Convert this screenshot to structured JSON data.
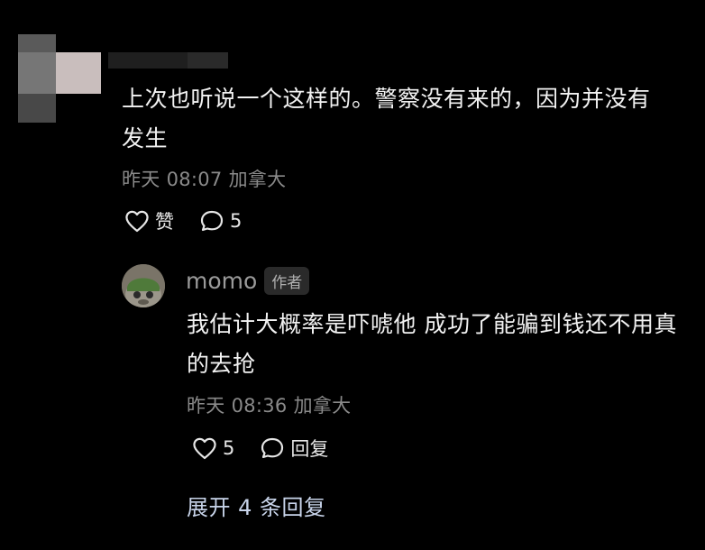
{
  "comment": {
    "text": "上次也听说一个这样的。警察没有来的，因为并没有发生",
    "meta": "昨天 08:07 加拿大",
    "like_label": "赞",
    "reply_count": "5"
  },
  "reply": {
    "username": "momo",
    "badge": "作者",
    "text": "我估计大概率是吓唬他 成功了能骗到钱还不用真的去抢",
    "meta": "昨天 08:36 加拿大",
    "like_count": "5",
    "reply_label": "回复"
  },
  "expand_label": "展开 4 条回复",
  "icons": {
    "like": "heart-outline-icon",
    "comment": "speech-bubble-icon"
  },
  "colors": {
    "background": "#000000",
    "text": "#f2f2f2",
    "meta": "#8a8a8a",
    "expand": "#c8d4ea"
  }
}
